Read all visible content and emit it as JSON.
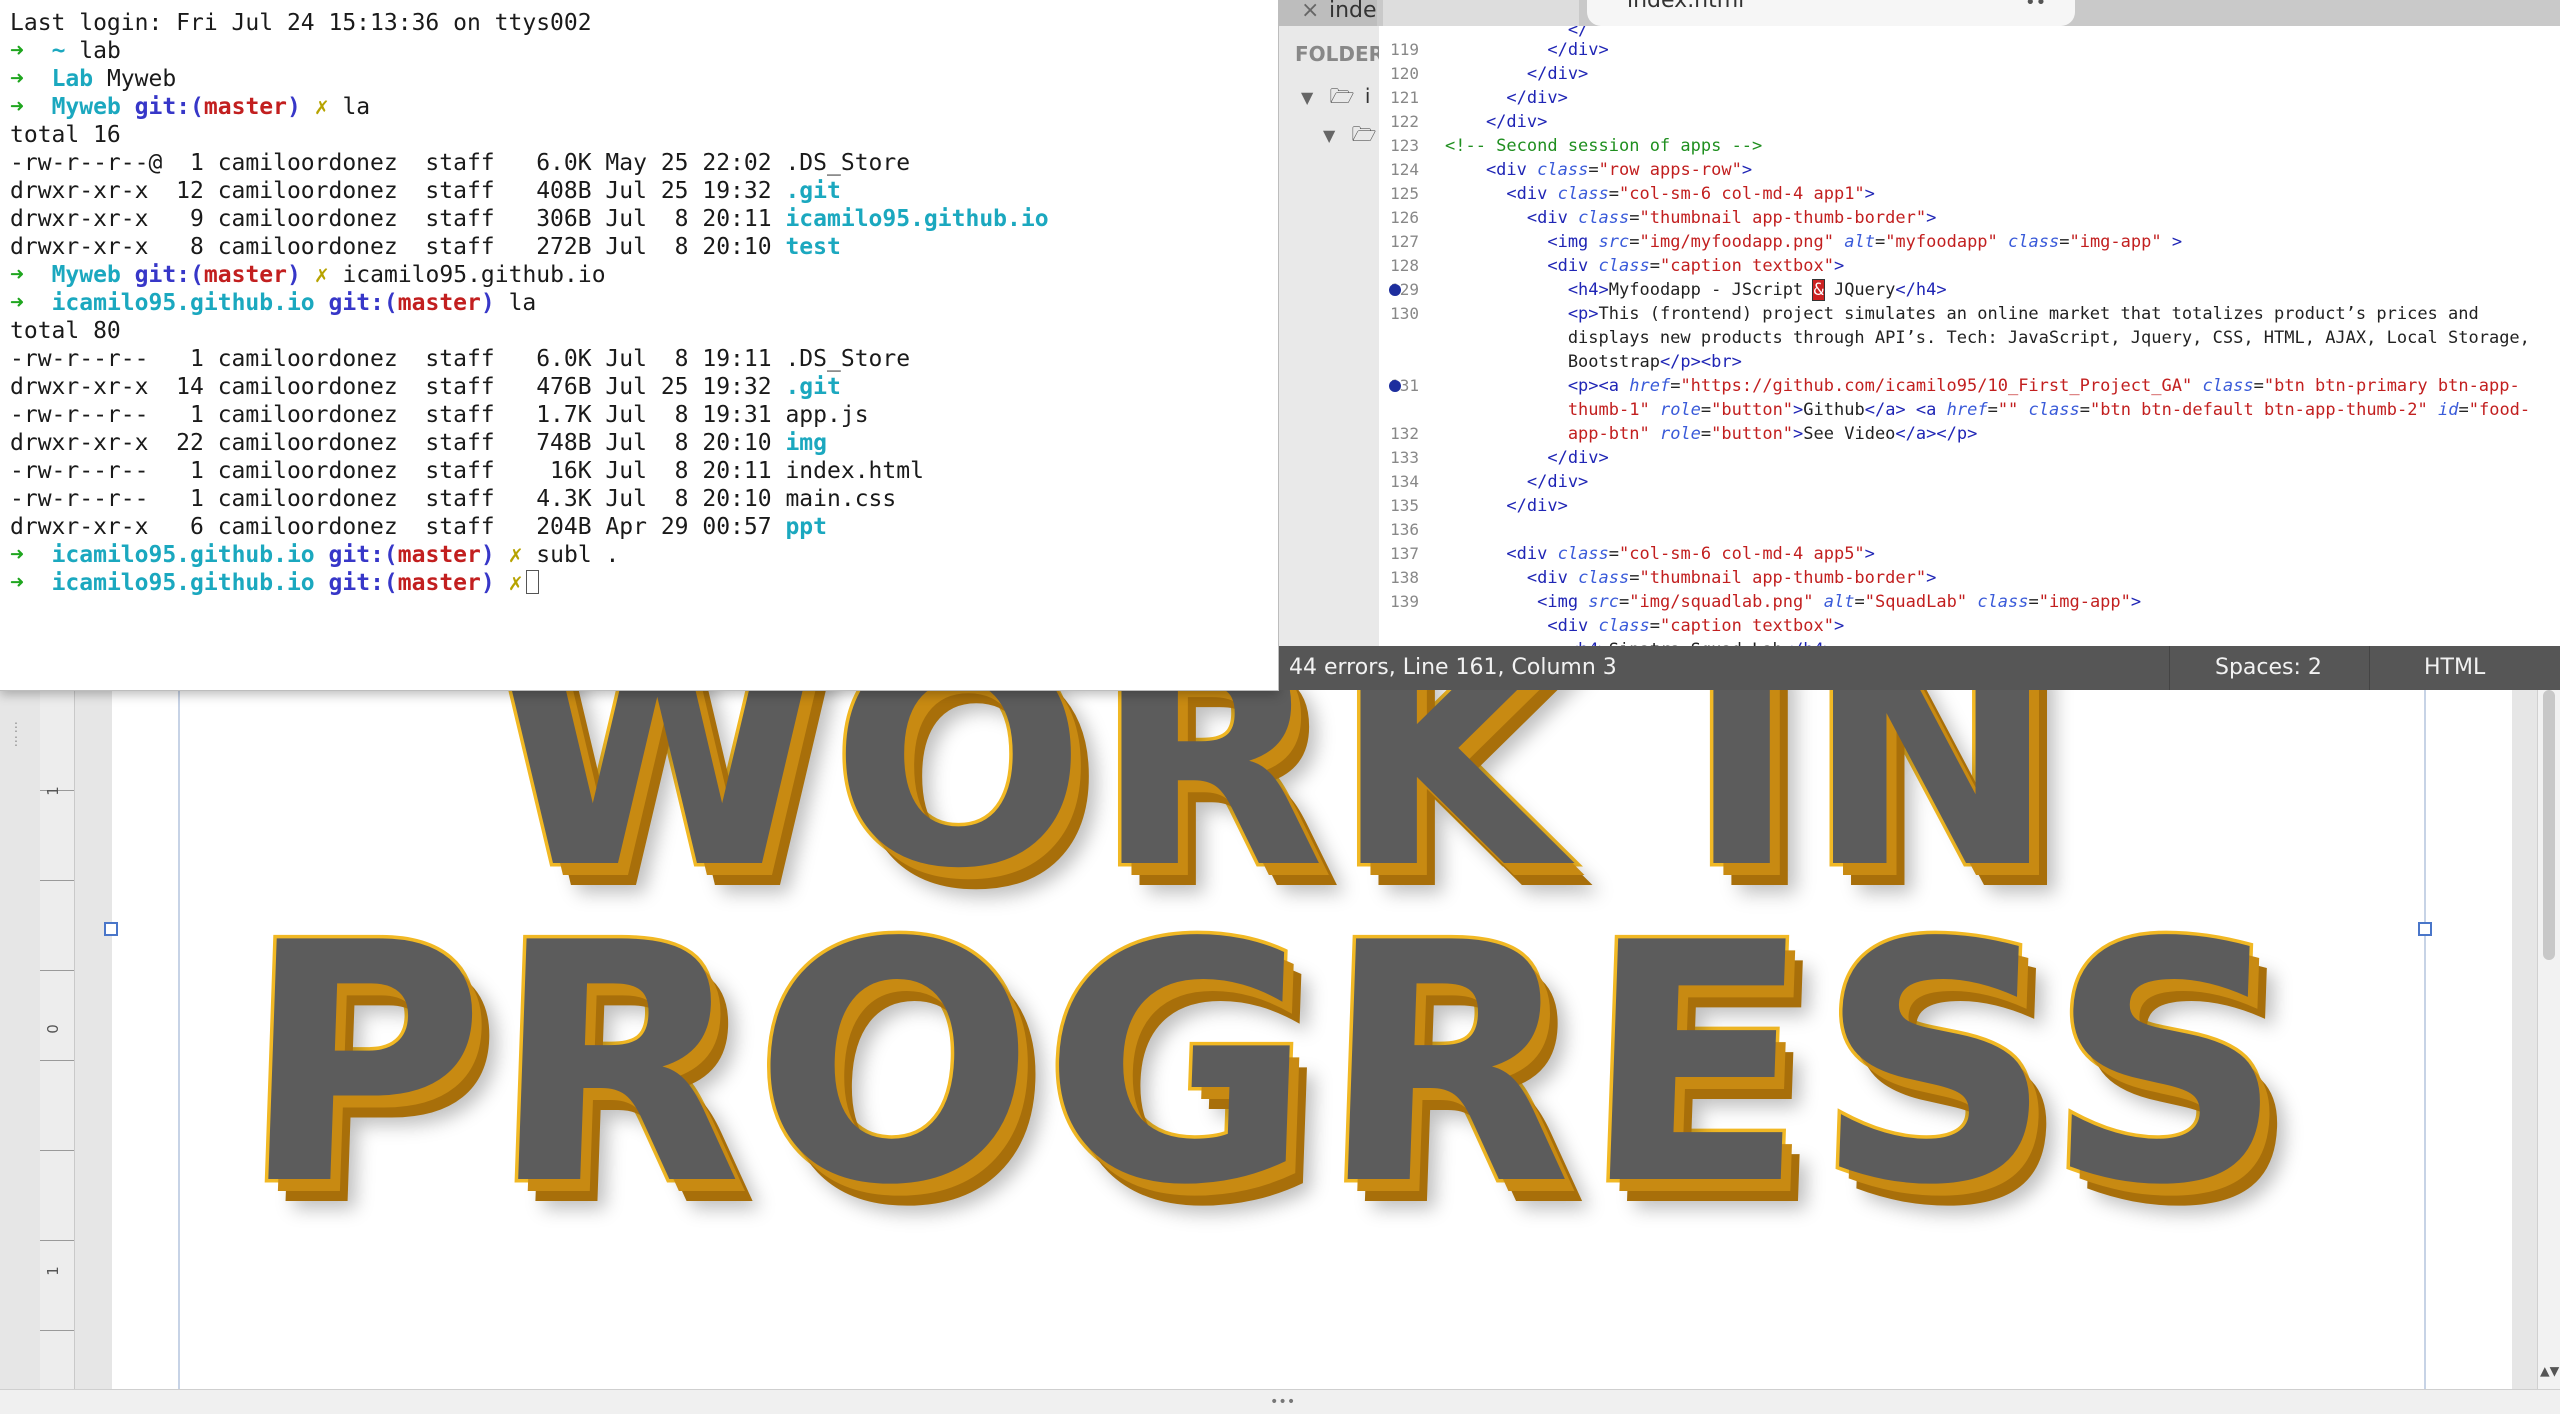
{
  "terminal": {
    "lines": [
      {
        "kind": "plain",
        "text": "Last login: Fri Jul 24 15:13:36 on ttys002"
      },
      {
        "kind": "prompt",
        "dir": "~",
        "git": "",
        "branch": "",
        "dirty": false,
        "cmd": " lab"
      },
      {
        "kind": "prompt",
        "dir": "Lab",
        "git": "",
        "branch": "",
        "dirty": false,
        "cmd": " Myweb"
      },
      {
        "kind": "prompt",
        "dir": "Myweb",
        "git": "git:(",
        "branch": "master",
        "dirty": true,
        "cmd": " la"
      },
      {
        "kind": "plain",
        "text": "total 16"
      },
      {
        "kind": "file",
        "text": "-rw-r--r--@  1 camiloordonez  staff   6.0K May 25 22:02 ",
        "name": ".DS_Store",
        "color": "plain"
      },
      {
        "kind": "file",
        "text": "drwxr-xr-x  12 camiloordonez  staff   408B Jul 25 19:32 ",
        "name": ".git",
        "color": "cyan"
      },
      {
        "kind": "file",
        "text": "drwxr-xr-x   9 camiloordonez  staff   306B Jul  8 20:11 ",
        "name": "icamilo95.github.io",
        "color": "cyan"
      },
      {
        "kind": "file",
        "text": "drwxr-xr-x   8 camiloordonez  staff   272B Jul  8 20:10 ",
        "name": "test",
        "color": "cyan"
      },
      {
        "kind": "prompt",
        "dir": "Myweb",
        "git": "git:(",
        "branch": "master",
        "dirty": true,
        "cmd": " icamilo95.github.io"
      },
      {
        "kind": "prompt",
        "dir": "icamilo95.github.io",
        "git": "git:(",
        "branch": "master",
        "dirty": false,
        "cmd": " la"
      },
      {
        "kind": "plain",
        "text": "total 80"
      },
      {
        "kind": "file",
        "text": "-rw-r--r--   1 camiloordonez  staff   6.0K Jul  8 19:11 ",
        "name": ".DS_Store",
        "color": "plain"
      },
      {
        "kind": "file",
        "text": "drwxr-xr-x  14 camiloordonez  staff   476B Jul 25 19:32 ",
        "name": ".git",
        "color": "cyan"
      },
      {
        "kind": "file",
        "text": "-rw-r--r--   1 camiloordonez  staff   1.7K Jul  8 19:31 ",
        "name": "app.js",
        "color": "plain"
      },
      {
        "kind": "file",
        "text": "drwxr-xr-x  22 camiloordonez  staff   748B Jul  8 20:10 ",
        "name": "img",
        "color": "cyan"
      },
      {
        "kind": "file",
        "text": "-rw-r--r--   1 camiloordonez  staff    16K Jul  8 20:11 ",
        "name": "index.html",
        "color": "plain"
      },
      {
        "kind": "file",
        "text": "-rw-r--r--   1 camiloordonez  staff   4.3K Jul  8 20:10 ",
        "name": "main.css",
        "color": "plain"
      },
      {
        "kind": "file",
        "text": "drwxr-xr-x   6 camiloordonez  staff   204B Apr 29 00:57 ",
        "name": "ppt",
        "color": "cyan"
      },
      {
        "kind": "prompt",
        "dir": "icamilo95.github.io",
        "git": "git:(",
        "branch": "master",
        "dirty": true,
        "cmd": " subl ."
      },
      {
        "kind": "prompt",
        "dir": "icamilo95.github.io",
        "git": "git:(",
        "branch": "master",
        "dirty": true,
        "cmd": "",
        "cursor": true
      }
    ],
    "arrow": "➜",
    "dirty_mark": "✗",
    "git_close": ")"
  },
  "sublime": {
    "tabs": [
      {
        "label": "inde",
        "close": "×"
      },
      {
        "label": "index.html",
        "close": "••"
      }
    ],
    "sidebar": {
      "title": "FOLDER",
      "rows": [
        {
          "arrow": "▼",
          "icon": "🗁",
          "label": "i"
        },
        {
          "arrow": "▼",
          "icon": "🗁",
          "label": ""
        }
      ]
    },
    "line_numbers": [
      "",
      "119",
      "120",
      "121",
      "122",
      "123",
      "124",
      "125",
      "126",
      "127",
      "128",
      "129",
      "130",
      "",
      "",
      "131",
      "",
      "132",
      "133",
      "134",
      "135",
      "136",
      "137",
      "138",
      "139"
    ],
    "breakpoint_lines": [
      "129",
      "131"
    ],
    "status": {
      "message": "44 errors, Line 161, Column 3",
      "spaces": "Spaces: 2",
      "syntax": "HTML"
    }
  },
  "document": {
    "ruler_labels": [
      "1",
      "0",
      "1"
    ],
    "artwork_lines": [
      "WORK IN",
      "PROGRESS"
    ],
    "grip": "•••",
    "scroll_arrows": "▲▼"
  },
  "colors": {
    "terminal_green": "#1fa61f",
    "terminal_cyan": "#1ba8bf",
    "terminal_blue": "#3737c8",
    "terminal_red": "#c21f1f",
    "statusbar": "#565656",
    "wip_yellow": "#f1b824"
  }
}
